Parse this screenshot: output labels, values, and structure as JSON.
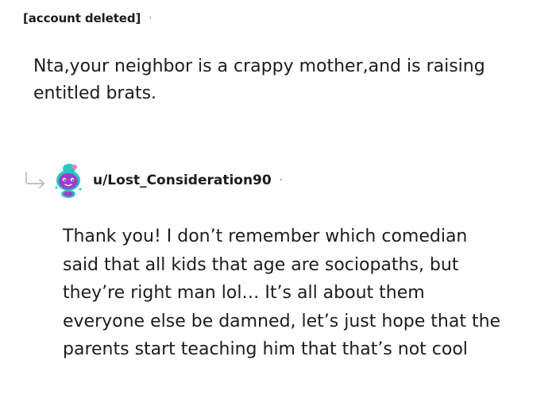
{
  "comment": {
    "author": "[account deleted]",
    "separator": "·",
    "lines": [
      "Nta,your neighbor is a crappy mother,and is raising",
      "entitled brats."
    ]
  },
  "reply": {
    "author": "u/Lost_Consideration90",
    "separator": "·",
    "reply_icon": "reply-arrow-icon",
    "avatar_icon": "snoo-avatar-icon",
    "lines": [
      "Thank you! I don’t remember which comedian",
      "said that all kids that age are sociopaths, but",
      "they’re right man lol… It’s all about them",
      "everyone else be damned, let’s just hope that the",
      "parents start teaching him that that’s not cool"
    ]
  },
  "colors": {
    "text": "#1c1c1c",
    "meta": "#7c7c7c",
    "reply_arrow": "#c0c4c8",
    "avatar_bg": "#2ec4c0",
    "avatar_face": "#9b3fd1"
  }
}
